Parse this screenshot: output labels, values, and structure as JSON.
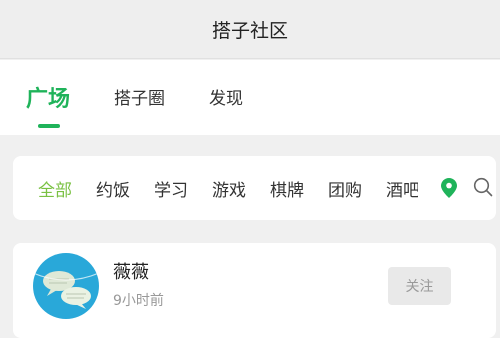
{
  "header": {
    "title": "搭子社区"
  },
  "tabs": [
    {
      "label": "广场",
      "active": true
    },
    {
      "label": "搭子圈",
      "active": false
    },
    {
      "label": "发现",
      "active": false
    }
  ],
  "filters": {
    "items": [
      "全部",
      "约饭",
      "学习",
      "游戏",
      "棋牌",
      "团购",
      "酒吧"
    ],
    "selected": "全部",
    "location_icon": "location-pin-icon",
    "search_icon": "search-icon"
  },
  "post": {
    "user_name": "薇薇",
    "time": "9小时前",
    "follow_label": "关注",
    "avatar_icon": "chat-bubbles-avatar"
  },
  "colors": {
    "accent_green": "#1fb35a",
    "filter_selected": "#7ac143",
    "avatar_bg": "#29a8d9"
  }
}
